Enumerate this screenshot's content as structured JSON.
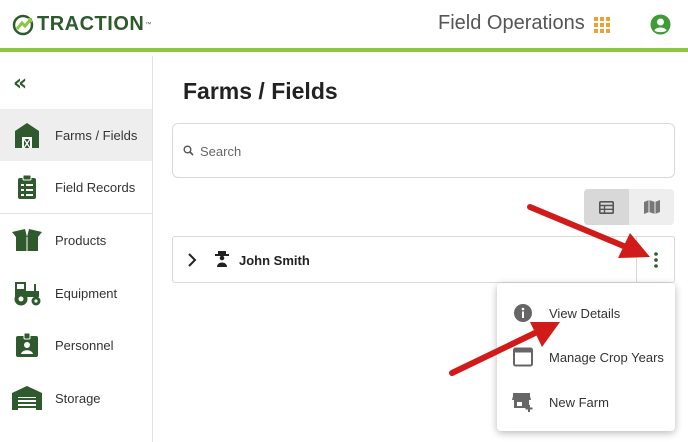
{
  "header": {
    "brand": "TRACTION",
    "brand_tm": "™",
    "app_title": "Field Operations",
    "icons": [
      "apps-grid-icon",
      "account-circle-icon"
    ],
    "accent_color": "#8dc63f",
    "brand_color": "#2e5a2e"
  },
  "sidebar": {
    "collapse_label": "«",
    "items": [
      {
        "label": "Farms / Fields",
        "icon": "barn-icon",
        "active": true
      },
      {
        "label": "Field Records",
        "icon": "clipboard-icon",
        "active": false
      },
      {
        "label": "Products",
        "icon": "box-icon",
        "active": false
      },
      {
        "label": "Equipment",
        "icon": "tractor-icon",
        "active": false
      },
      {
        "label": "Personnel",
        "icon": "badge-icon",
        "active": false
      },
      {
        "label": "Storage",
        "icon": "warehouse-icon",
        "active": false
      }
    ]
  },
  "main": {
    "title": "Farms / Fields",
    "search_placeholder": "Search",
    "view_toggle": [
      "table-view-icon",
      "map-view-icon"
    ],
    "farms": [
      {
        "name": "John Smith"
      }
    ],
    "menu": [
      {
        "label": "View Details",
        "icon": "info-icon"
      },
      {
        "label": "Manage Crop Years",
        "icon": "calendar-icon"
      },
      {
        "label": "New Farm",
        "icon": "add-store-icon"
      }
    ]
  },
  "annotations": {
    "arrow_color": "#d11a1a"
  }
}
